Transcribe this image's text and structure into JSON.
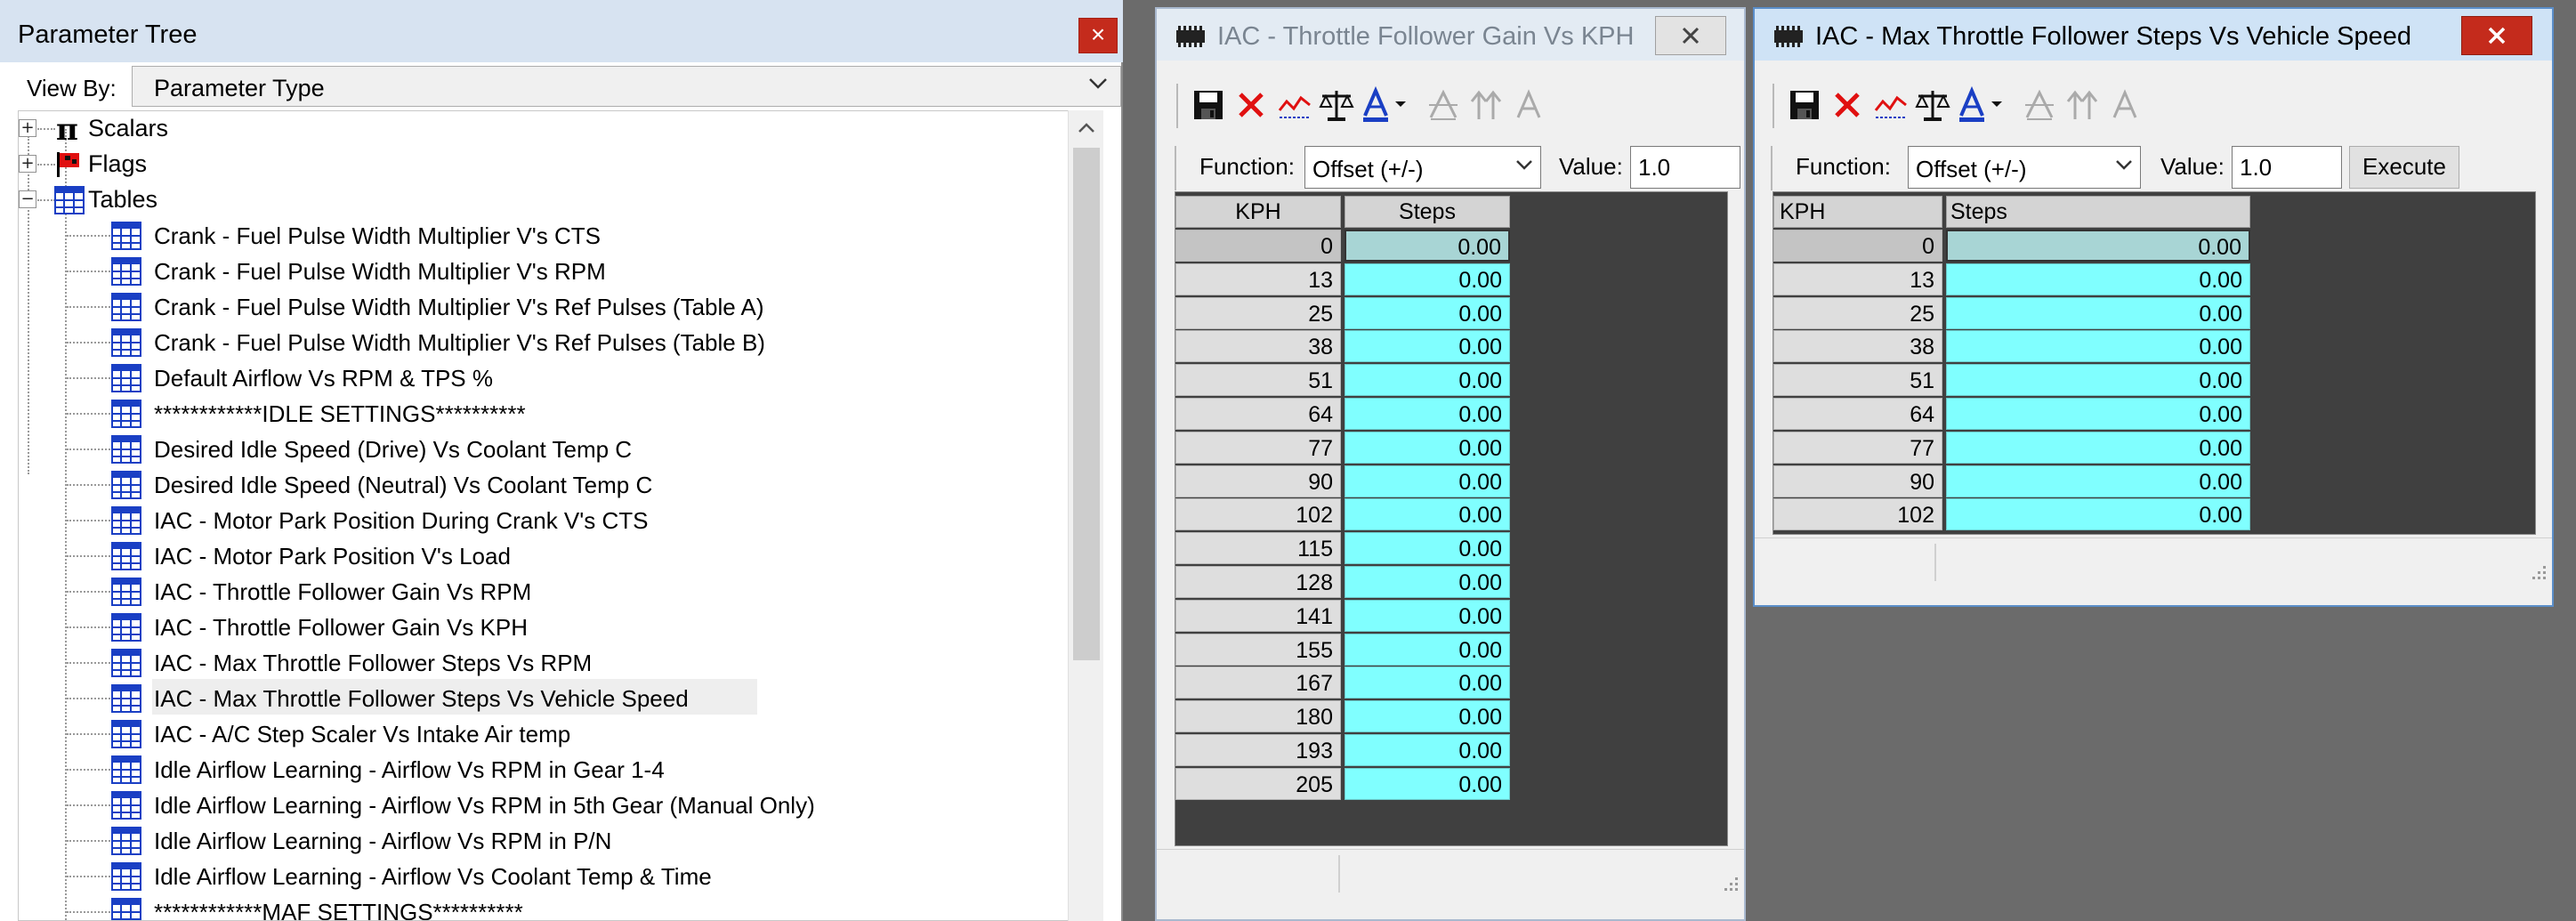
{
  "param_tree": {
    "title": "Parameter Tree",
    "close_label": "×",
    "view_by_label": "View By:",
    "view_by_value": "Parameter Type",
    "nodes": [
      {
        "label": "Scalars",
        "expander": "+",
        "icon": "pi-icon"
      },
      {
        "label": "Flags",
        "expander": "+",
        "icon": "flag-icon"
      },
      {
        "label": "Tables",
        "expander": "−",
        "icon": "table-icon"
      }
    ],
    "tables": [
      "Crank - Fuel Pulse Width Multiplier V's CTS",
      "Crank - Fuel Pulse Width Multiplier V's RPM",
      "Crank - Fuel Pulse Width Multiplier V's Ref Pulses (Table A)",
      "Crank - Fuel Pulse Width Multiplier V's Ref Pulses (Table B)",
      "Default Airflow Vs RPM & TPS %",
      "************IDLE SETTINGS**********",
      "Desired Idle Speed (Drive) Vs Coolant Temp C",
      "Desired Idle Speed (Neutral) Vs Coolant Temp C",
      "IAC - Motor Park Position During Crank V's CTS",
      "IAC - Motor Park Position V's Load",
      "IAC - Throttle Follower Gain Vs RPM",
      "IAC - Throttle Follower Gain Vs KPH",
      "IAC - Max Throttle Follower Steps Vs RPM",
      "IAC - Max Throttle Follower Steps Vs Vehicle Speed",
      "IAC - A/C Step Scaler Vs Intake Air temp",
      "Idle Airflow Learning - Airflow Vs RPM in Gear 1-4",
      "Idle Airflow Learning - Airflow Vs RPM in 5th Gear (Manual Only)",
      "Idle Airflow Learning - Airflow Vs RPM in P/N",
      "Idle Airflow Learning - Airflow Vs Coolant Temp & Time",
      "************MAF SETTINGS**********"
    ],
    "selected_index": 13
  },
  "win1": {
    "title": "IAC - Throttle Follower Gain Vs KPH",
    "function_label": "Function:",
    "function_value": "Offset (+/-)",
    "value_label": "Value:",
    "value": "1.0",
    "col_header_row": "KPH",
    "col_header_val": "Steps",
    "rows": [
      {
        "kph": "0",
        "steps": "0.00"
      },
      {
        "kph": "13",
        "steps": "0.00"
      },
      {
        "kph": "25",
        "steps": "0.00"
      },
      {
        "kph": "38",
        "steps": "0.00"
      },
      {
        "kph": "51",
        "steps": "0.00"
      },
      {
        "kph": "64",
        "steps": "0.00"
      },
      {
        "kph": "77",
        "steps": "0.00"
      },
      {
        "kph": "90",
        "steps": "0.00"
      },
      {
        "kph": "102",
        "steps": "0.00"
      },
      {
        "kph": "115",
        "steps": "0.00"
      },
      {
        "kph": "128",
        "steps": "0.00"
      },
      {
        "kph": "141",
        "steps": "0.00"
      },
      {
        "kph": "155",
        "steps": "0.00"
      },
      {
        "kph": "167",
        "steps": "0.00"
      },
      {
        "kph": "180",
        "steps": "0.00"
      },
      {
        "kph": "193",
        "steps": "0.00"
      },
      {
        "kph": "205",
        "steps": "0.00"
      }
    ]
  },
  "win2": {
    "title": "IAC - Max Throttle Follower Steps Vs Vehicle Speed",
    "function_label": "Function:",
    "function_value": "Offset (+/-)",
    "value_label": "Value:",
    "value": "1.0",
    "execute_label": "Execute",
    "col_header_row": "KPH",
    "col_header_val": "Steps",
    "rows": [
      {
        "kph": "0",
        "steps": "0.00"
      },
      {
        "kph": "13",
        "steps": "0.00"
      },
      {
        "kph": "25",
        "steps": "0.00"
      },
      {
        "kph": "38",
        "steps": "0.00"
      },
      {
        "kph": "51",
        "steps": "0.00"
      },
      {
        "kph": "64",
        "steps": "0.00"
      },
      {
        "kph": "77",
        "steps": "0.00"
      },
      {
        "kph": "90",
        "steps": "0.00"
      },
      {
        "kph": "102",
        "steps": "0.00"
      }
    ]
  },
  "toolbar_icons": [
    "save-icon",
    "delete-icon",
    "graph-icon",
    "compare-icon",
    "font-color-icon",
    "cut-icon",
    "interpolate-icon",
    "font-icon"
  ],
  "colors": {
    "cell_bg": "#80ffff",
    "selected_cell_bg": "#a8d5d5",
    "active_title_bg": "#cfe3f6",
    "inactive_title_bg": "#e3ebf3",
    "close_red": "#c42b1c",
    "grid_bg": "#404040"
  }
}
